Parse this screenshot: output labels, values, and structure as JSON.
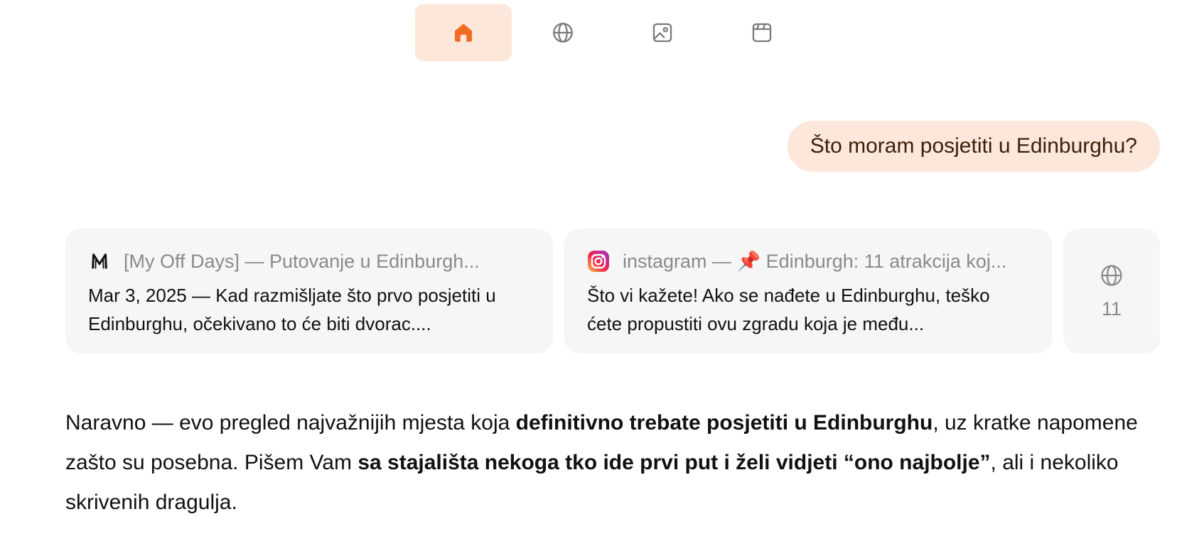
{
  "tabs": [
    {
      "icon": "home-icon",
      "active": true
    },
    {
      "icon": "globe-icon",
      "active": false
    },
    {
      "icon": "image-icon",
      "active": false
    },
    {
      "icon": "video-icon",
      "active": false
    }
  ],
  "accent_color": "#f26b22",
  "user_message": "Što moram posjetiti u Edinburghu?",
  "sources": [
    {
      "logo": "my-off-days-logo-icon",
      "title": "[My Off Days] — Putovanje u Edinburgh...",
      "snippet": "Mar 3, 2025 — Kad razmišljate što prvo posjetiti u Edinburghu, očekivano to će biti dvorac...."
    },
    {
      "logo": "instagram-logo-icon",
      "title": "instagram — 📌 Edinburgh: 11 atrakcija koj...",
      "snippet": "Što vi kažete! Ako se nađete u Edinburghu, teško ćete propustiti ovu zgradu koja je među..."
    }
  ],
  "more_sources_count": "11",
  "answer": {
    "p1": "Naravno — evo pregled najvažnijih mjesta koja ",
    "b1": "definitivno trebate posjetiti u Edinburghu",
    "p2": ", uz kratke napomene zašto su posebna. Pišem Vam ",
    "b2": "sa stajališta nekoga tko ide prvi put i želi vidjeti “ono najbolje”",
    "p3": ", ali i nekoliko skrivenih dragulja."
  }
}
